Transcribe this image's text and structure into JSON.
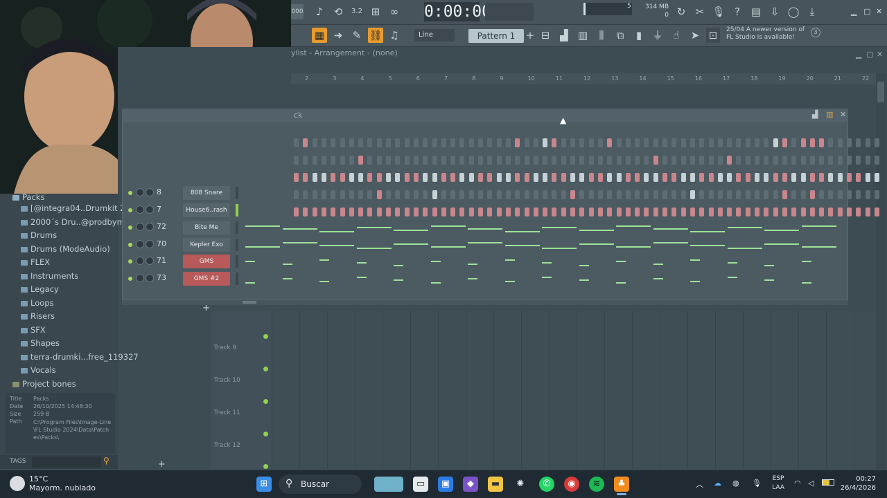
{
  "toolbar": {
    "time": "0:00:00",
    "time_unit": "M:S:CS",
    "snap_mode": "Line",
    "pattern": "Pattern 1",
    "memory": "314 MB",
    "voices": "0",
    "cpu_small": "5",
    "notice_date": "25/04",
    "notice_text": "A newer version of FL Studio is available!",
    "notice_badge": "3"
  },
  "playlist": {
    "title": "ylist - Arrangement",
    "pattern_sel": "(none)",
    "ruler": [
      "2",
      "3",
      "4",
      "5",
      "6",
      "7",
      "8",
      "9",
      "10",
      "11",
      "12",
      "13",
      "14",
      "15",
      "16",
      "17",
      "18",
      "19",
      "20",
      "21",
      "22"
    ],
    "tracks": [
      "Track 9",
      "Track 10",
      "Track 11",
      "Track 12"
    ]
  },
  "channel_rack": {
    "title_fragment": "ck",
    "channels": [
      {
        "num": "8",
        "name": "808 Snare"
      },
      {
        "num": "7",
        "name": "House6..rash 03"
      },
      {
        "num": "72",
        "name": "Bite Me"
      },
      {
        "num": "70",
        "name": "Kepler Exo"
      },
      {
        "num": "71",
        "name": "GMS"
      },
      {
        "num": "73",
        "name": "GMS #2"
      }
    ],
    "add_symbol": "+"
  },
  "browser": {
    "root": "Packs",
    "items": [
      "[@integra04..Drumkit 2023",
      "2000´s Dru..@prodbymati",
      "Drums",
      "Drums (ModeAudio)",
      "FLEX",
      "Instruments",
      "Legacy",
      "Loops",
      "Risers",
      "SFX",
      "Shapes",
      "terra-drumki...free_119327",
      "Vocals"
    ],
    "project_bones": "Project bones",
    "info": {
      "title_label": "Title",
      "title_value": "Packs",
      "date_label": "Date",
      "date_value": "26/10/2025 14:48:30",
      "size_label": "Size",
      "size_value": "259 B",
      "path_label": "Path",
      "path_value": "C:\\Program Files\\Image-Line\\FL Studio 2024\\Data\\Patches\\Packs\\"
    },
    "tags_label": "TAGS",
    "add_symbol": "+"
  },
  "taskbar": {
    "weather_temp": "15°C",
    "weather_desc": "Mayorm. nublado",
    "search": "Buscar",
    "lang_top": "ESP",
    "lang_bottom": "LAA",
    "time": "00:27",
    "date": "26/4/2026"
  },
  "colors": {
    "pink_step": "#c9868d",
    "white_step": "#c6d1d5",
    "note_green": "#9fe39b",
    "accent_orange": "#f0b34a"
  }
}
